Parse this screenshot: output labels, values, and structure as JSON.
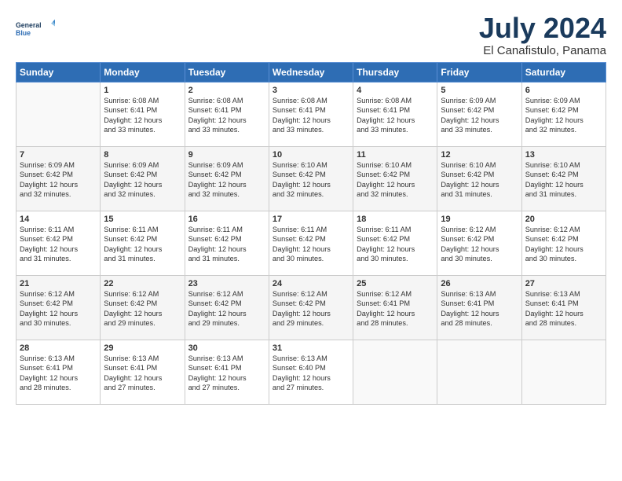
{
  "logo": {
    "line1": "General",
    "line2": "Blue"
  },
  "title": "July 2024",
  "location": "El Canafistulo, Panama",
  "days_header": [
    "Sunday",
    "Monday",
    "Tuesday",
    "Wednesday",
    "Thursday",
    "Friday",
    "Saturday"
  ],
  "weeks": [
    [
      {
        "day": "",
        "info": ""
      },
      {
        "day": "1",
        "info": "Sunrise: 6:08 AM\nSunset: 6:41 PM\nDaylight: 12 hours\nand 33 minutes."
      },
      {
        "day": "2",
        "info": "Sunrise: 6:08 AM\nSunset: 6:41 PM\nDaylight: 12 hours\nand 33 minutes."
      },
      {
        "day": "3",
        "info": "Sunrise: 6:08 AM\nSunset: 6:41 PM\nDaylight: 12 hours\nand 33 minutes."
      },
      {
        "day": "4",
        "info": "Sunrise: 6:08 AM\nSunset: 6:41 PM\nDaylight: 12 hours\nand 33 minutes."
      },
      {
        "day": "5",
        "info": "Sunrise: 6:09 AM\nSunset: 6:42 PM\nDaylight: 12 hours\nand 33 minutes."
      },
      {
        "day": "6",
        "info": "Sunrise: 6:09 AM\nSunset: 6:42 PM\nDaylight: 12 hours\nand 32 minutes."
      }
    ],
    [
      {
        "day": "7",
        "info": "Sunrise: 6:09 AM\nSunset: 6:42 PM\nDaylight: 12 hours\nand 32 minutes."
      },
      {
        "day": "8",
        "info": "Sunrise: 6:09 AM\nSunset: 6:42 PM\nDaylight: 12 hours\nand 32 minutes."
      },
      {
        "day": "9",
        "info": "Sunrise: 6:09 AM\nSunset: 6:42 PM\nDaylight: 12 hours\nand 32 minutes."
      },
      {
        "day": "10",
        "info": "Sunrise: 6:10 AM\nSunset: 6:42 PM\nDaylight: 12 hours\nand 32 minutes."
      },
      {
        "day": "11",
        "info": "Sunrise: 6:10 AM\nSunset: 6:42 PM\nDaylight: 12 hours\nand 32 minutes."
      },
      {
        "day": "12",
        "info": "Sunrise: 6:10 AM\nSunset: 6:42 PM\nDaylight: 12 hours\nand 31 minutes."
      },
      {
        "day": "13",
        "info": "Sunrise: 6:10 AM\nSunset: 6:42 PM\nDaylight: 12 hours\nand 31 minutes."
      }
    ],
    [
      {
        "day": "14",
        "info": "Sunrise: 6:11 AM\nSunset: 6:42 PM\nDaylight: 12 hours\nand 31 minutes."
      },
      {
        "day": "15",
        "info": "Sunrise: 6:11 AM\nSunset: 6:42 PM\nDaylight: 12 hours\nand 31 minutes."
      },
      {
        "day": "16",
        "info": "Sunrise: 6:11 AM\nSunset: 6:42 PM\nDaylight: 12 hours\nand 31 minutes."
      },
      {
        "day": "17",
        "info": "Sunrise: 6:11 AM\nSunset: 6:42 PM\nDaylight: 12 hours\nand 30 minutes."
      },
      {
        "day": "18",
        "info": "Sunrise: 6:11 AM\nSunset: 6:42 PM\nDaylight: 12 hours\nand 30 minutes."
      },
      {
        "day": "19",
        "info": "Sunrise: 6:12 AM\nSunset: 6:42 PM\nDaylight: 12 hours\nand 30 minutes."
      },
      {
        "day": "20",
        "info": "Sunrise: 6:12 AM\nSunset: 6:42 PM\nDaylight: 12 hours\nand 30 minutes."
      }
    ],
    [
      {
        "day": "21",
        "info": "Sunrise: 6:12 AM\nSunset: 6:42 PM\nDaylight: 12 hours\nand 30 minutes."
      },
      {
        "day": "22",
        "info": "Sunrise: 6:12 AM\nSunset: 6:42 PM\nDaylight: 12 hours\nand 29 minutes."
      },
      {
        "day": "23",
        "info": "Sunrise: 6:12 AM\nSunset: 6:42 PM\nDaylight: 12 hours\nand 29 minutes."
      },
      {
        "day": "24",
        "info": "Sunrise: 6:12 AM\nSunset: 6:42 PM\nDaylight: 12 hours\nand 29 minutes."
      },
      {
        "day": "25",
        "info": "Sunrise: 6:12 AM\nSunset: 6:41 PM\nDaylight: 12 hours\nand 28 minutes."
      },
      {
        "day": "26",
        "info": "Sunrise: 6:13 AM\nSunset: 6:41 PM\nDaylight: 12 hours\nand 28 minutes."
      },
      {
        "day": "27",
        "info": "Sunrise: 6:13 AM\nSunset: 6:41 PM\nDaylight: 12 hours\nand 28 minutes."
      }
    ],
    [
      {
        "day": "28",
        "info": "Sunrise: 6:13 AM\nSunset: 6:41 PM\nDaylight: 12 hours\nand 28 minutes."
      },
      {
        "day": "29",
        "info": "Sunrise: 6:13 AM\nSunset: 6:41 PM\nDaylight: 12 hours\nand 27 minutes."
      },
      {
        "day": "30",
        "info": "Sunrise: 6:13 AM\nSunset: 6:41 PM\nDaylight: 12 hours\nand 27 minutes."
      },
      {
        "day": "31",
        "info": "Sunrise: 6:13 AM\nSunset: 6:40 PM\nDaylight: 12 hours\nand 27 minutes."
      },
      {
        "day": "",
        "info": ""
      },
      {
        "day": "",
        "info": ""
      },
      {
        "day": "",
        "info": ""
      }
    ]
  ]
}
